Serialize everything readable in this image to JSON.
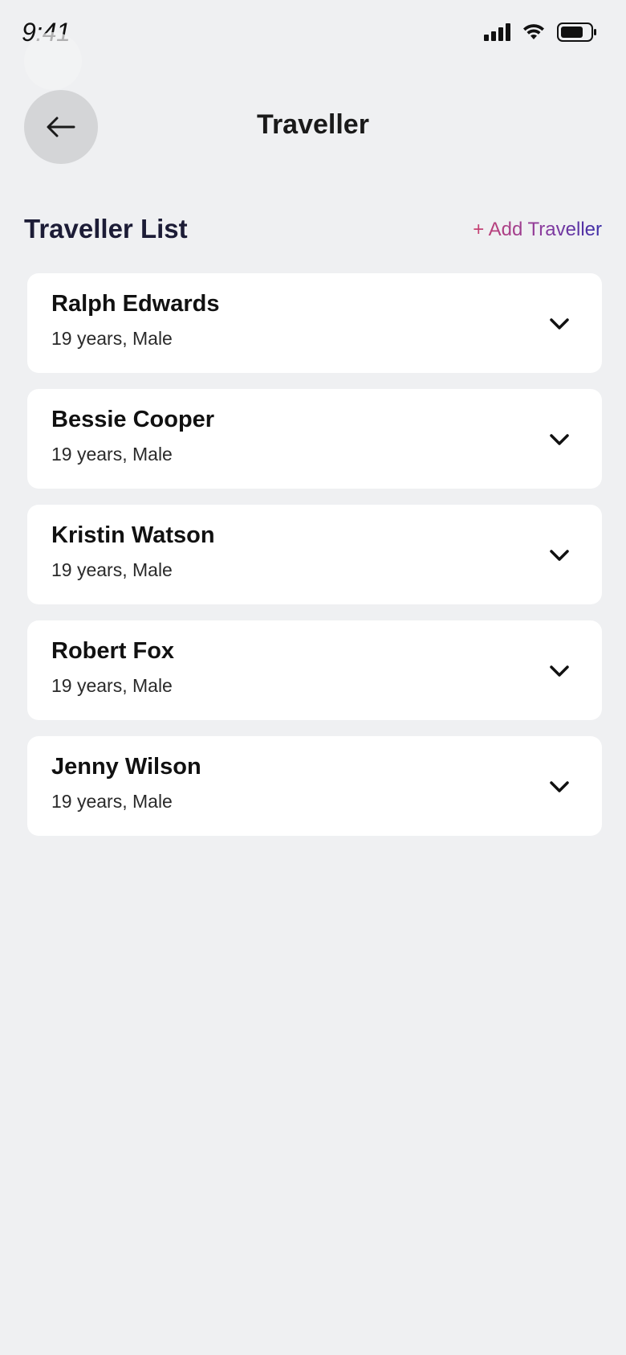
{
  "status_bar": {
    "time": "9:41"
  },
  "header": {
    "title": "Traveller",
    "back_icon": "arrow-left-icon"
  },
  "section": {
    "title": "Traveller List",
    "add_label": "+ Add Traveller",
    "add_gradient": [
      "#c94270",
      "#8a3b9e",
      "#3b2ea8"
    ]
  },
  "travellers": [
    {
      "name": "Ralph Edwards",
      "detail": "19 years, Male"
    },
    {
      "name": "Bessie Cooper",
      "detail": "19 years, Male"
    },
    {
      "name": "Kristin Watson",
      "detail": "19 years, Male"
    },
    {
      "name": "Robert Fox",
      "detail": "19 years, Male"
    },
    {
      "name": "Jenny Wilson",
      "detail": "19 years, Male"
    }
  ],
  "colors": {
    "background": "#eff0f2",
    "card": "#ffffff",
    "back_button": "#d4d5d7",
    "section_title": "#1c1c36"
  }
}
